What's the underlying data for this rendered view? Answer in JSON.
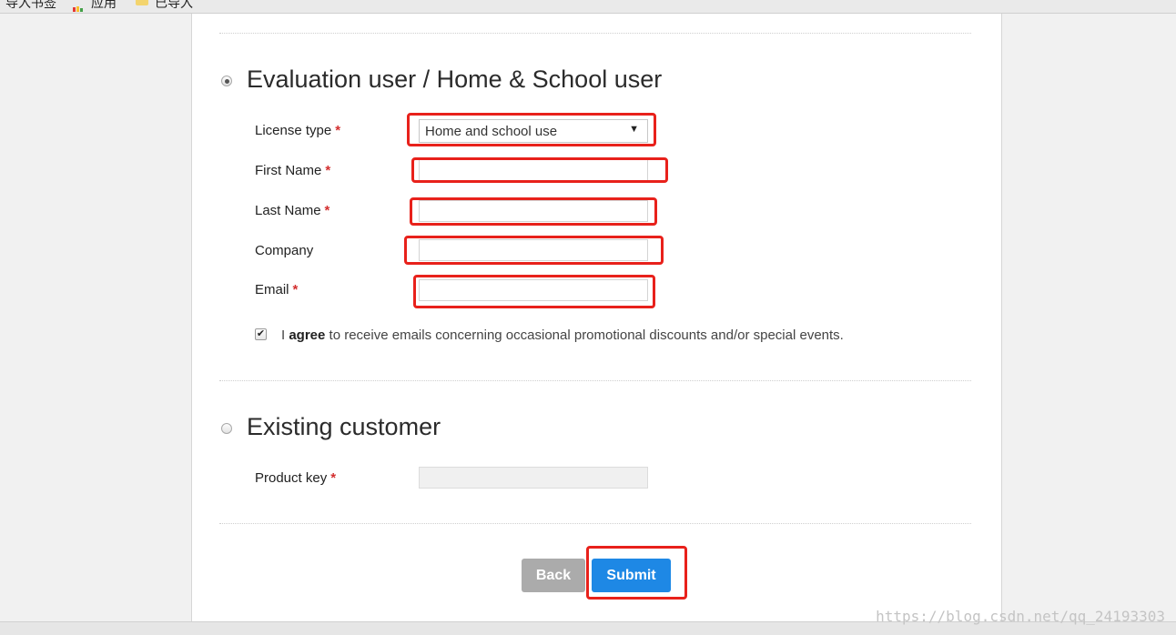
{
  "bookmarks_bar": {
    "items": [
      "导入书签",
      "应用",
      "已导入"
    ]
  },
  "evaluation_section": {
    "radio_selected": true,
    "title": "Evaluation user / Home & School user",
    "fields": {
      "license_type": {
        "label": "License type",
        "required_mark": "*",
        "selected_value": "Home and school use"
      },
      "first_name": {
        "label": "First Name",
        "required_mark": "*",
        "value": ""
      },
      "last_name": {
        "label": "Last Name",
        "required_mark": "*",
        "value": ""
      },
      "company": {
        "label": "Company",
        "value": ""
      },
      "email": {
        "label": "Email",
        "required_mark": "*",
        "value": ""
      }
    },
    "consent": {
      "checked": true,
      "prefix": "I ",
      "bold": "agree",
      "suffix": " to receive emails concerning occasional promotional discounts and/or special events."
    }
  },
  "existing_section": {
    "radio_selected": false,
    "title": "Existing customer",
    "product_key": {
      "label": "Product key",
      "required_mark": "*",
      "value": ""
    }
  },
  "buttons": {
    "back": "Back",
    "submit": "Submit"
  },
  "watermark": "https://blog.csdn.net/qq_24193303",
  "colors": {
    "highlight": "#e8211b",
    "submit": "#1e88e5",
    "back": "#ababab",
    "required": "#d32f2f"
  }
}
